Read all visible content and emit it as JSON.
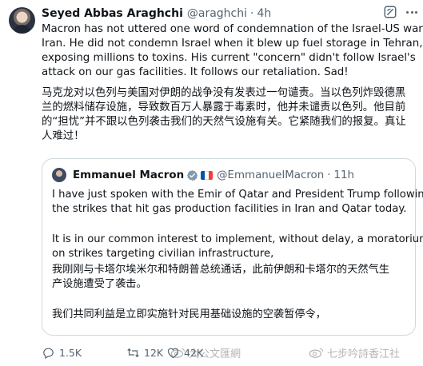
{
  "tweet": {
    "author_name": "Seyed Abbas Araghchi",
    "handle": "@araghchi",
    "separator": "·",
    "time": "4h",
    "body_en": [
      "Macron has not uttered one word of condemnation of the Israel-US war on",
      "Iran. He did not condemn Israel when it blew up fuel storage in Tehran,",
      "exposing millions to toxins. His current \"concern\" didn't follow Israel's",
      "attack on our gas facilities. It follows our retaliation. Sad!"
    ],
    "body_zh": [
      "马克龙对以色列与美国对伊朗的战争没有发表过一句谴责。当以色列炸毁德黑",
      "兰的燃料储存设施，导致数百万人暴露于毒素时，他并未谴责以色列。他目前",
      "的“担忧”并不跟以色列袭击我们的天然气设施有关。它紧随我们的报复。真让",
      "人难过！"
    ]
  },
  "quote": {
    "author_name": "Emmanuel Macron",
    "handle": "@EmmanuelMacron",
    "separator": "·",
    "time": "11h",
    "p1": [
      "I have just spoken with the Emir of Qatar and President Trump following",
      "the strikes that hit gas production facilities in Iran and Qatar today."
    ],
    "p2": [
      "It is in our common interest to implement, without delay, a moratorium",
      "on strikes targeting civilian infrastructure,"
    ],
    "p3": [
      "我刚刚与卡塔尔埃米尔和特朗普总统通话，此前伊朗和卡塔尔的天然气生",
      "产设施遭受了袭击。"
    ],
    "p4": [
      "我们共同利益是立即实施针对民用基础设施的空袭暂停令，"
    ]
  },
  "actions": {
    "replies": "1.5K",
    "reposts": "12K",
    "likes": "42K"
  },
  "watermarks": {
    "left": "大公文匯網",
    "right": "七步吟詩香江社"
  },
  "colors": {
    "text": "#0f1419",
    "muted": "#536471",
    "border": "#cfd9de",
    "verified": "#829aab"
  },
  "icons": [
    "grok-icon",
    "more-icon",
    "verified-icon",
    "flag-icon",
    "reply-icon",
    "repost-icon",
    "like-icon"
  ]
}
